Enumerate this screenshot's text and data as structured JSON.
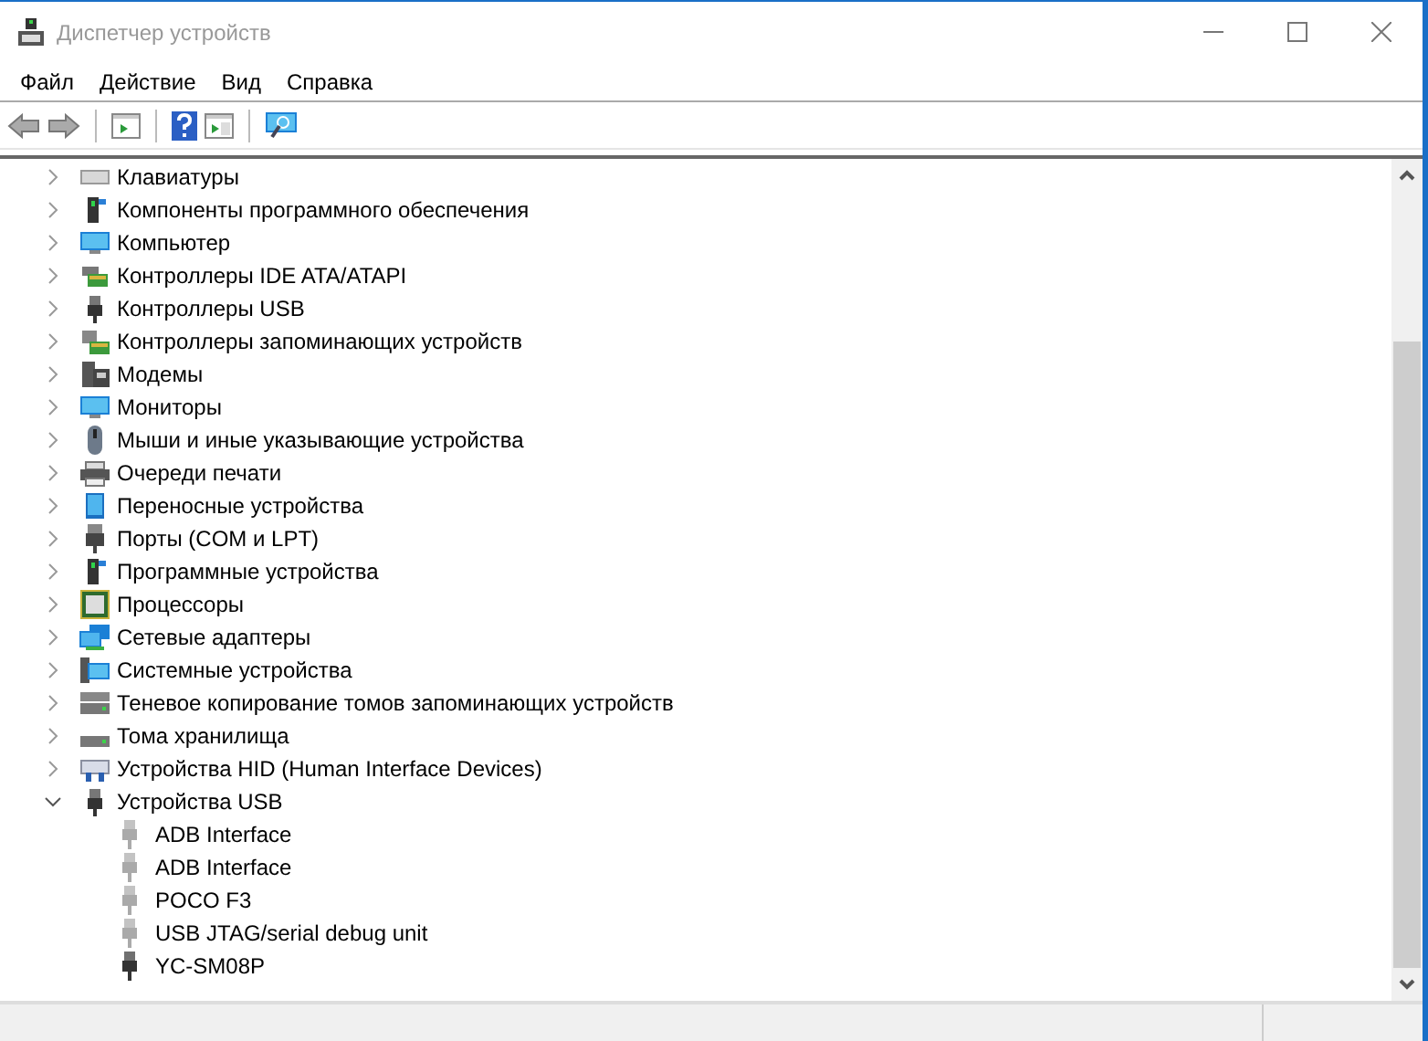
{
  "window": {
    "title": "Диспетчер устройств"
  },
  "menu": [
    "Файл",
    "Действие",
    "Вид",
    "Справка"
  ],
  "tree": [
    {
      "label": "Клавиатуры",
      "kind": "keyboard",
      "expanded": false
    },
    {
      "label": "Компоненты программного обеспечения",
      "kind": "software",
      "expanded": false
    },
    {
      "label": "Компьютер",
      "kind": "computer",
      "expanded": false
    },
    {
      "label": "Контроллеры IDE ATA/ATAPI",
      "kind": "card",
      "expanded": false
    },
    {
      "label": "Контроллеры USB",
      "kind": "usb",
      "expanded": false
    },
    {
      "label": "Контроллеры запоминающих устройств",
      "kind": "storage",
      "expanded": false
    },
    {
      "label": "Модемы",
      "kind": "modem",
      "expanded": false
    },
    {
      "label": "Мониторы",
      "kind": "computer",
      "expanded": false
    },
    {
      "label": "Мыши и иные указывающие устройства",
      "kind": "mouse",
      "expanded": false
    },
    {
      "label": "Очереди печати",
      "kind": "printer",
      "expanded": false
    },
    {
      "label": "Переносные устройства",
      "kind": "portable",
      "expanded": false
    },
    {
      "label": "Порты (COM и LPT)",
      "kind": "port",
      "expanded": false
    },
    {
      "label": "Программные устройства",
      "kind": "software",
      "expanded": false
    },
    {
      "label": "Процессоры",
      "kind": "processor",
      "expanded": false
    },
    {
      "label": "Сетевые адаптеры",
      "kind": "network",
      "expanded": false
    },
    {
      "label": "Системные устройства",
      "kind": "system",
      "expanded": false
    },
    {
      "label": "Теневое копирование томов запоминающих устройств",
      "kind": "drive",
      "expanded": false
    },
    {
      "label": "Тома хранилища",
      "kind": "volume",
      "expanded": false
    },
    {
      "label": "Устройства HID (Human Interface Devices)",
      "kind": "hid",
      "expanded": false
    },
    {
      "label": "Устройства USB",
      "kind": "usb",
      "expanded": true,
      "children": [
        {
          "label": "ADB Interface",
          "hidden": true
        },
        {
          "label": "ADB Interface",
          "hidden": true
        },
        {
          "label": "POCO F3",
          "hidden": true
        },
        {
          "label": "USB JTAG/serial debug unit",
          "hidden": true
        },
        {
          "label": "YC-SM08P",
          "hidden": false
        }
      ]
    }
  ]
}
